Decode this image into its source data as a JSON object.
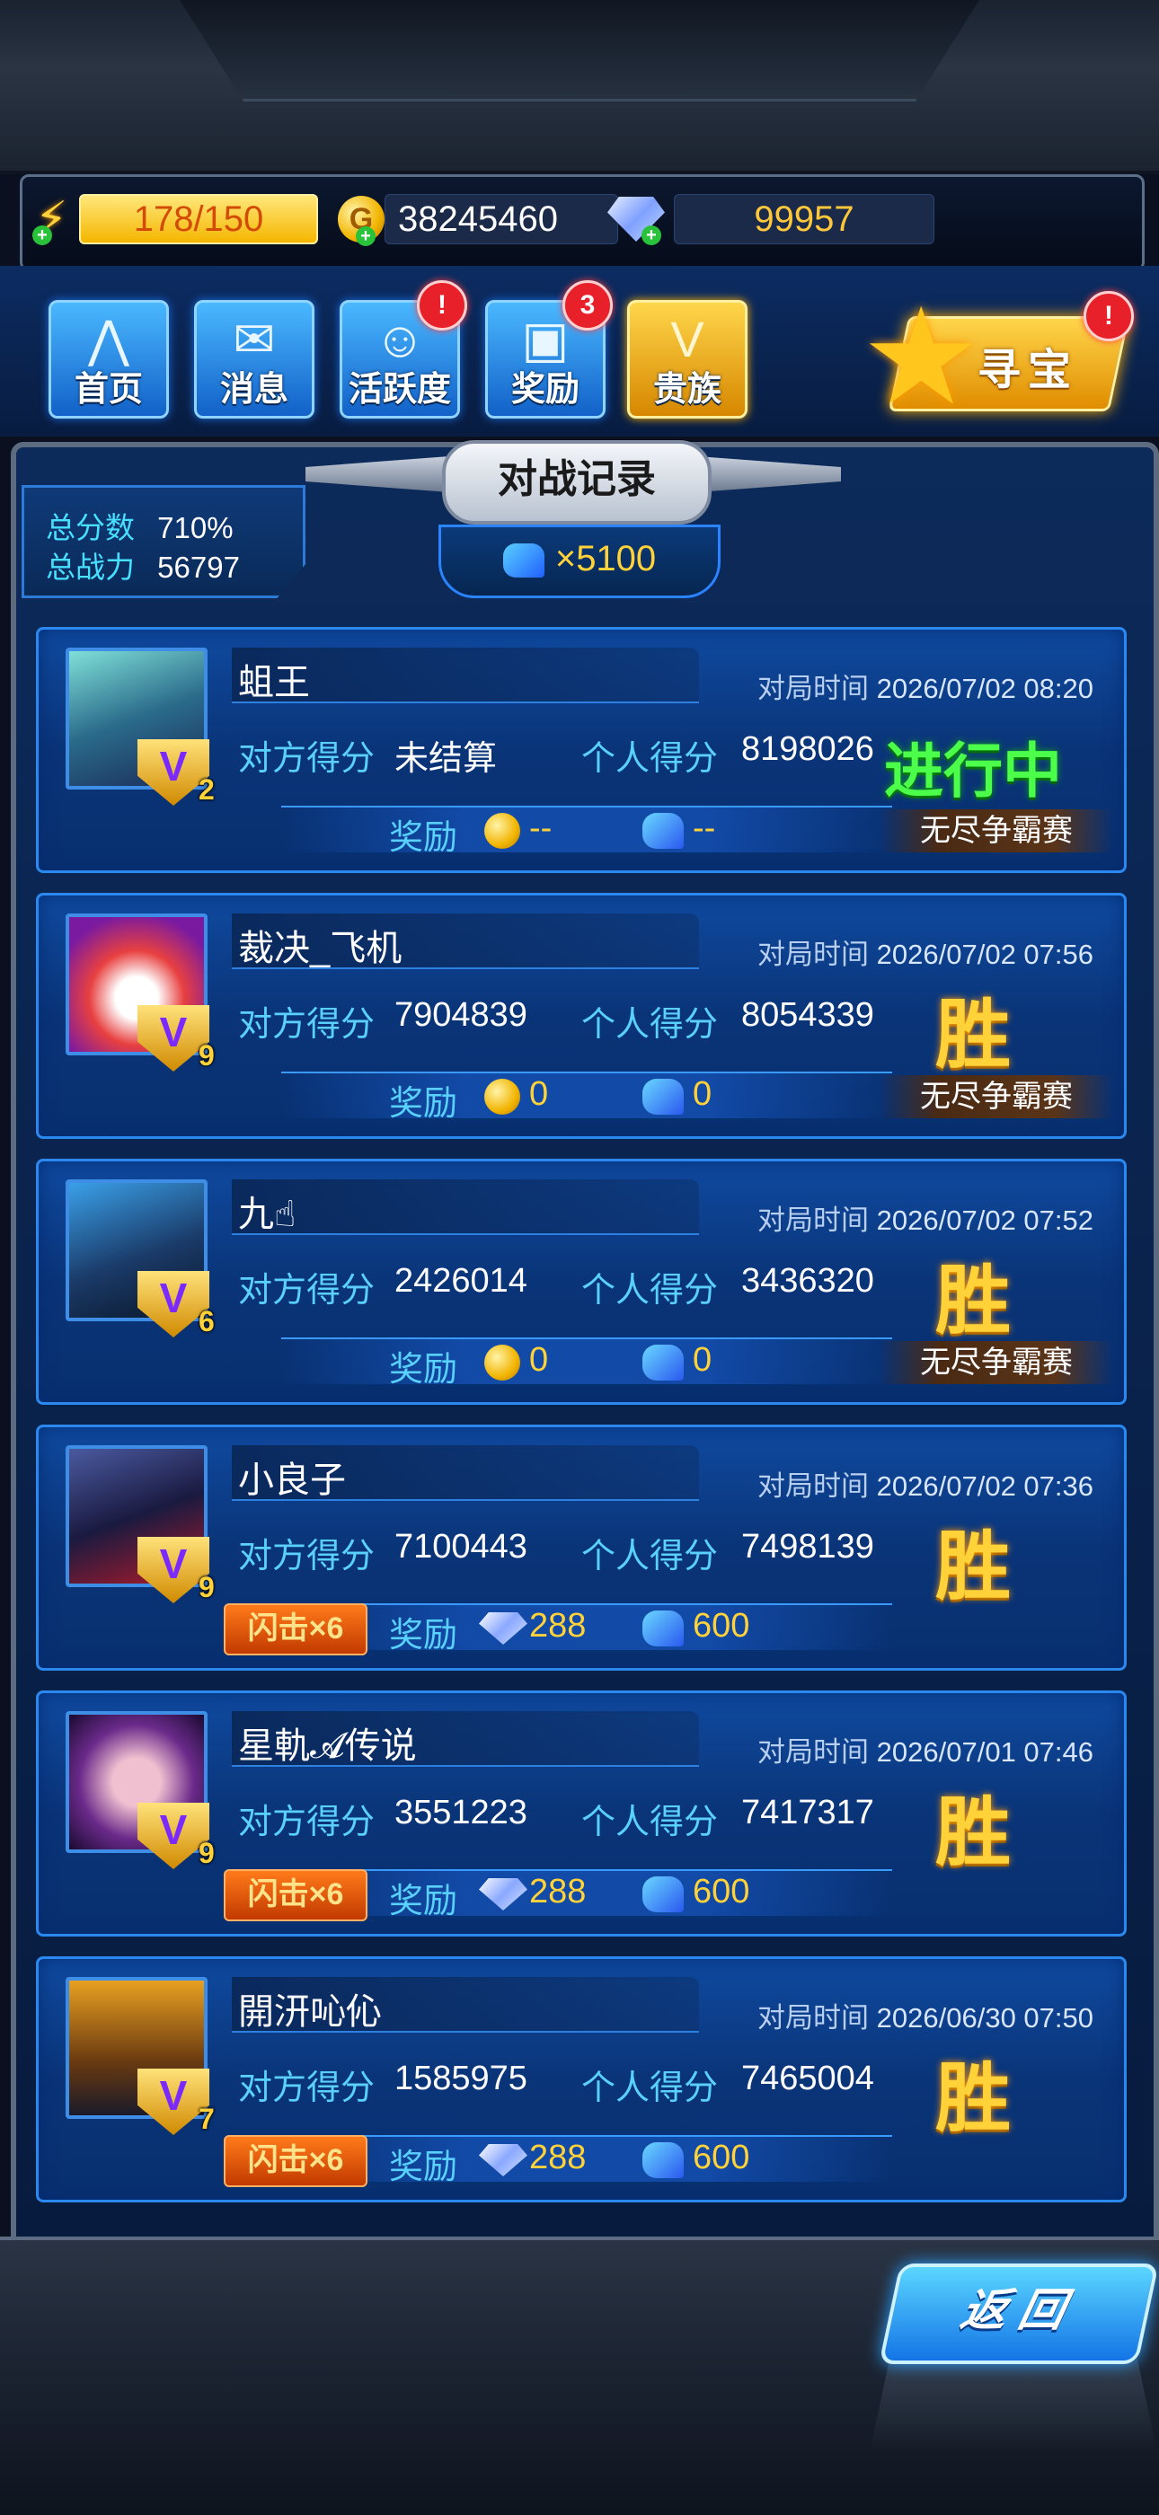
{
  "resources": {
    "energy": "178/150",
    "coins": "38245460",
    "gems": "99957"
  },
  "nav": {
    "home": "首页",
    "messages": "消息",
    "activity": "活跃度",
    "activity_badge": "!",
    "rewards": "奖励",
    "rewards_badge": "3",
    "noble": "贵族",
    "treasure": "寻宝",
    "treasure_badge": "!"
  },
  "panel": {
    "title": "对战记录",
    "total_score_label": "总分数",
    "total_score": "710%",
    "total_power_label": "总战力",
    "total_power": "56797",
    "pool": "×5100"
  },
  "labels": {
    "time": "对局时间",
    "opponent_score": "对方得分",
    "personal_score": "个人得分",
    "reward": "奖励"
  },
  "records": [
    {
      "name": "蛆王",
      "time": "2026/07/02 08:20",
      "opponent": "未结算",
      "personal": "8198026",
      "status": "进行中",
      "rank": "2",
      "reward_type": "coin",
      "reward1": "--",
      "reward2": "--",
      "tag": "无尽争霸赛"
    },
    {
      "name": "裁决_飞机",
      "time": "2026/07/02 07:56",
      "opponent": "7904839",
      "personal": "8054339",
      "status": "胜",
      "rank": "9",
      "reward_type": "coin",
      "reward1": "0",
      "reward2": "0",
      "tag": "无尽争霸赛"
    },
    {
      "name": "九☝",
      "time": "2026/07/02 07:52",
      "opponent": "2426014",
      "personal": "3436320",
      "status": "胜",
      "rank": "6",
      "reward_type": "coin",
      "reward1": "0",
      "reward2": "0",
      "tag": "无尽争霸赛"
    },
    {
      "name": "小良子",
      "time": "2026/07/02 07:36",
      "opponent": "7100443",
      "personal": "7498139",
      "status": "胜",
      "rank": "9",
      "reward_type": "gem",
      "reward1": "288",
      "reward2": "600",
      "combo": "闪击×6"
    },
    {
      "name": "星軌𝓐传说",
      "time": "2026/07/01 07:46",
      "opponent": "3551223",
      "personal": "7417317",
      "status": "胜",
      "rank": "9",
      "reward_type": "gem",
      "reward1": "288",
      "reward2": "600",
      "combo": "闪击×6"
    },
    {
      "name": "開汧吣伈",
      "time": "2026/06/30 07:50",
      "opponent": "1585975",
      "personal": "7465004",
      "status": "胜",
      "rank": "7",
      "reward_type": "gem",
      "reward1": "288",
      "reward2": "600",
      "combo": "闪击×6"
    }
  ],
  "buttons": {
    "back": "返回"
  },
  "colors": {
    "accent_blue": "#2a88ee",
    "gold": "#ffd23a",
    "live_green": "#4bff4a",
    "label_cyan": "#5ad0ff"
  },
  "icons": [
    "energy-icon",
    "coin-icon",
    "gem-icon",
    "chip-icon",
    "star-icon",
    "rank-badge"
  ]
}
